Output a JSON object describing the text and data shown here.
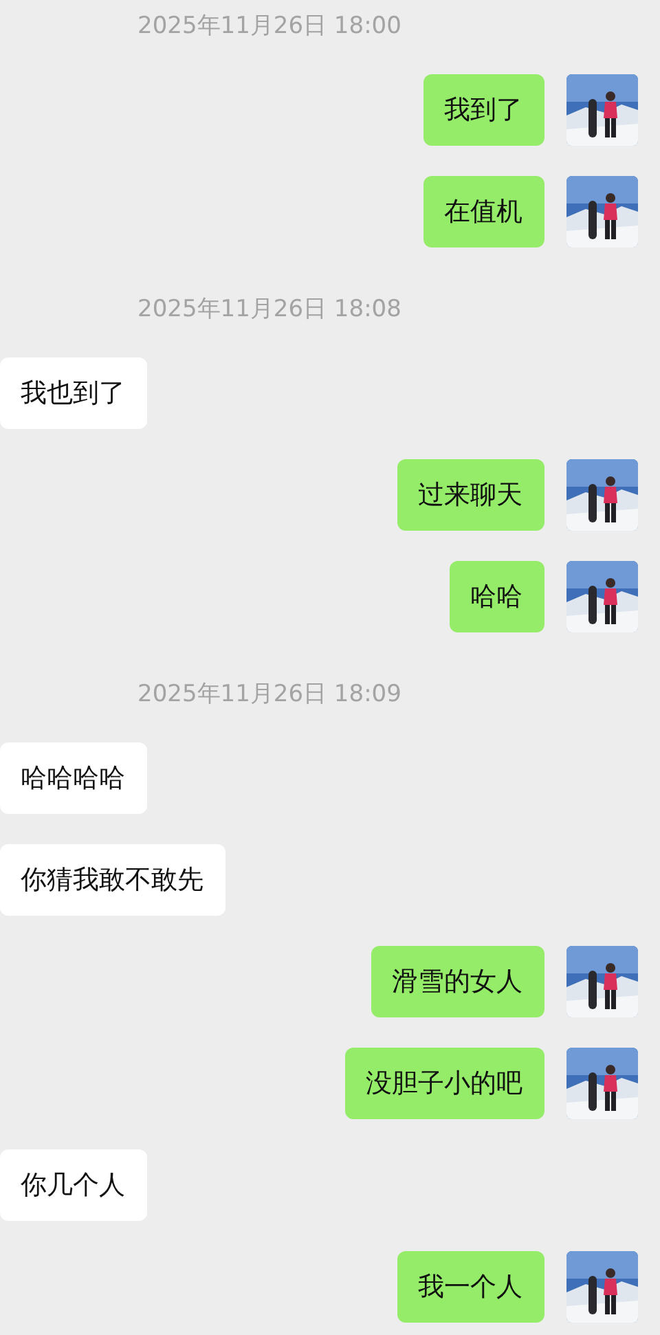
{
  "messages": [
    {
      "kind": "time",
      "text": "2025年11月26日 18:00"
    },
    {
      "kind": "sent",
      "text": "我到了"
    },
    {
      "kind": "sent",
      "text": "在值机"
    },
    {
      "kind": "time",
      "text": "2025年11月26日 18:08"
    },
    {
      "kind": "received",
      "text": "我也到了"
    },
    {
      "kind": "sent",
      "text": "过来聊天"
    },
    {
      "kind": "sent",
      "text": "哈哈"
    },
    {
      "kind": "time",
      "text": "2025年11月26日 18:09"
    },
    {
      "kind": "received",
      "text": "哈哈哈哈"
    },
    {
      "kind": "received",
      "text": "你猜我敢不敢先"
    },
    {
      "kind": "sent",
      "text": "滑雪的女人"
    },
    {
      "kind": "sent",
      "text": "没胆子小的吧"
    },
    {
      "kind": "received",
      "text": "你几个人"
    },
    {
      "kind": "sent",
      "text": "我一个人"
    }
  ]
}
